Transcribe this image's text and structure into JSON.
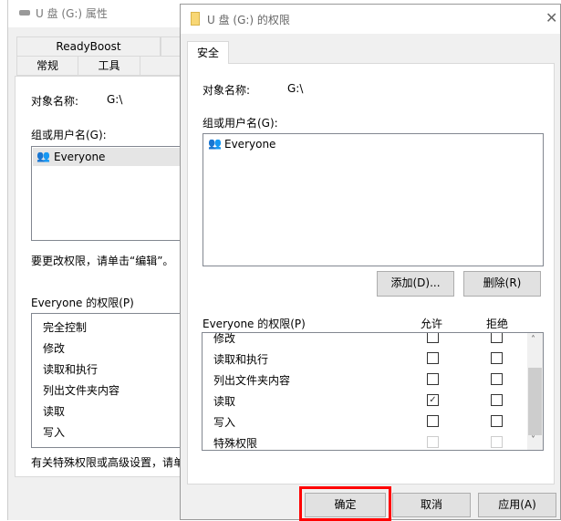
{
  "back": {
    "title": "U 盘 (G:) 属性",
    "tabs_row1": [
      "ReadyBoost",
      ""
    ],
    "tabs_row2": [
      "常规",
      "工具",
      ""
    ],
    "object_label": "对象名称:",
    "object_value": "G:\\",
    "group_label": "组或用户名(G):",
    "users": [
      "Everyone"
    ],
    "edit_hint": "要更改权限，请单击“编辑”。",
    "perm_label": "Everyone 的权限(P)",
    "perms": [
      "完全控制",
      "修改",
      "读取和执行",
      "列出文件夹内容",
      "读取",
      "写入"
    ],
    "special_hint": "有关特殊权限或高级设置，请单"
  },
  "front": {
    "title": "U 盘 (G:) 的权限",
    "tab": "安全",
    "object_label": "对象名称:",
    "object_value": "G:\\",
    "group_label": "组或用户名(G):",
    "users": [
      "Everyone"
    ],
    "add_button": "添加(D)...",
    "remove_button": "删除(R)",
    "perm_label": "Everyone 的权限(P)",
    "allow_header": "允许",
    "deny_header": "拒绝",
    "perms": [
      {
        "name": "修改",
        "allow": false,
        "deny": false
      },
      {
        "name": "读取和执行",
        "allow": false,
        "deny": false
      },
      {
        "name": "列出文件夹内容",
        "allow": false,
        "deny": false
      },
      {
        "name": "读取",
        "allow": true,
        "deny": false
      },
      {
        "name": "写入",
        "allow": false,
        "deny": false
      },
      {
        "name": "特殊权限",
        "allow": false,
        "deny": false,
        "disabled": true
      }
    ],
    "ok_button": "确定",
    "cancel_button": "取消",
    "apply_button": "应用(A)",
    "highlight_color": "#ff0000"
  }
}
